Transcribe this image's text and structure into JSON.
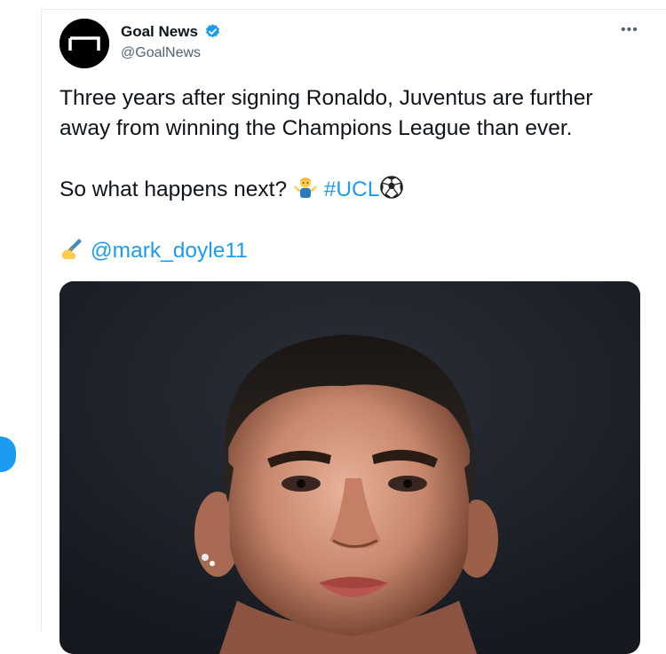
{
  "tweet": {
    "author": {
      "display_name": "Goal News",
      "handle": "@GoalNews",
      "verified": true,
      "avatar_icon": "goal-logo-icon"
    },
    "more_icon": "more-options-icon",
    "more_glyph": "•••",
    "text": {
      "line1": "Three years after signing Ronaldo, Juventus are further",
      "line2": "away from winning the Champions League than ever.",
      "line3_prefix": "So what happens next?",
      "shrug_emoji_icon": "person-shrugging-emoji",
      "hashtag": "#UCL",
      "soccer_ball_icon": "soccer-ball-emoji",
      "writing_hand_icon": "writing-hand-emoji",
      "mention": "@mark_doyle11"
    },
    "media": {
      "type": "photo",
      "subject_icon": "player-photo"
    }
  },
  "colors": {
    "link": "#1d9bf0",
    "text": "#0f1419",
    "secondary": "#536471",
    "verified": "#1d9bf0",
    "media_bg": "#1d2128"
  }
}
